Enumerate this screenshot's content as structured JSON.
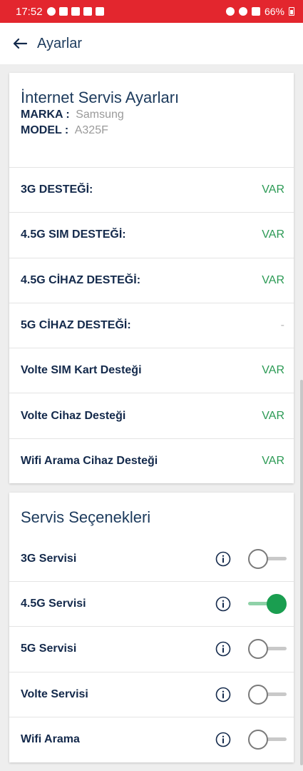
{
  "status_bar": {
    "time": "17:52",
    "battery": "66%"
  },
  "app_bar": {
    "title": "Ayarlar"
  },
  "internet_settings": {
    "title": "İnternet Servis Ayarları",
    "brand_key": "MARKA :",
    "brand_value": "Samsung",
    "model_key": "MODEL :",
    "model_value": "A325F",
    "rows": [
      {
        "label": "3G DESTEĞİ:",
        "value": "VAR"
      },
      {
        "label": "4.5G SIM DESTEĞİ:",
        "value": "VAR"
      },
      {
        "label": "4.5G CİHAZ DESTEĞİ:",
        "value": "VAR"
      },
      {
        "label": "5G CİHAZ DESTEĞİ:",
        "value": "-"
      },
      {
        "label": "Volte SIM Kart Desteği",
        "value": "VAR"
      },
      {
        "label": "Volte Cihaz Desteği",
        "value": "VAR"
      },
      {
        "label": "Wifi Arama Cihaz Desteği",
        "value": "VAR"
      }
    ]
  },
  "service_options": {
    "title": "Servis Seçenekleri",
    "items": [
      {
        "label": "3G Servisi",
        "enabled": false
      },
      {
        "label": "4.5G Servisi",
        "enabled": true
      },
      {
        "label": "5G Servisi",
        "enabled": false
      },
      {
        "label": "Volte Servisi",
        "enabled": false
      },
      {
        "label": "Wifi Arama",
        "enabled": false
      }
    ]
  },
  "colors": {
    "status_bar": "#e3262e",
    "accent_green": "#1a9e50",
    "text_navy": "#13294b"
  }
}
